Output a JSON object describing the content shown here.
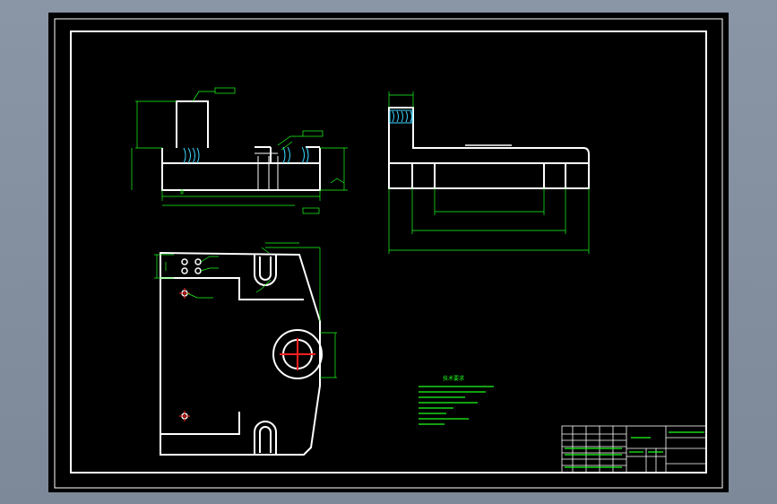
{
  "drawing": {
    "notes": {
      "title": "技术要求",
      "lines": [
        "",
        "",
        "",
        "",
        "",
        ""
      ]
    },
    "title_block": {
      "part_name": "",
      "drawing_no": "",
      "material": ""
    },
    "dimensions": [],
    "colors": {
      "background": "#000000",
      "outline": "#ffffff",
      "dimension": "#1cff1c",
      "centerline": "#ff2020",
      "hatch": "#3cd6ff"
    }
  }
}
